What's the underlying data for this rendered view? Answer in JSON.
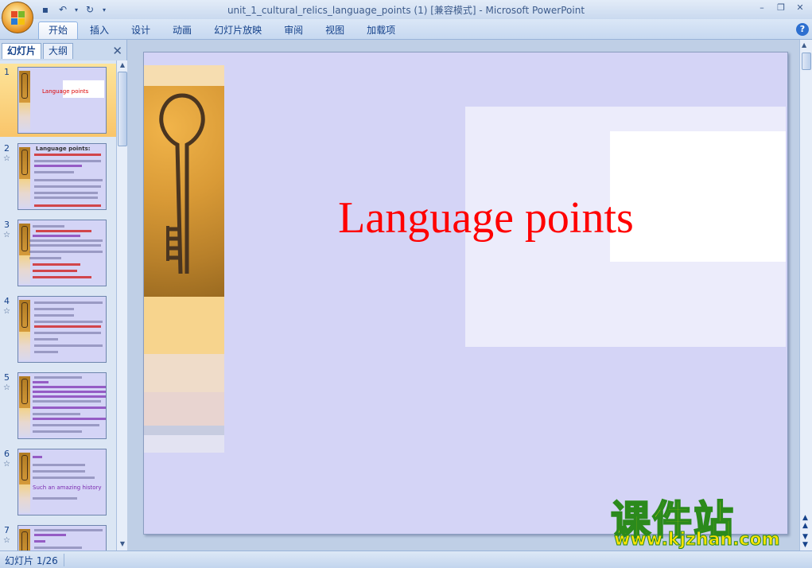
{
  "window": {
    "title": "unit_1_cultural_relics_language_points (1) [兼容模式] - Microsoft PowerPoint"
  },
  "ribbon": {
    "tabs": [
      "开始",
      "插入",
      "设计",
      "动画",
      "幻灯片放映",
      "审阅",
      "视图",
      "加载项"
    ],
    "active_tab": "开始"
  },
  "panel": {
    "tabs": [
      "幻灯片",
      "大纲"
    ],
    "active_tab": "幻灯片",
    "close_label": "✕",
    "thumbnails": [
      {
        "number": "1",
        "title": "Language points",
        "has_animation": false
      },
      {
        "number": "2",
        "title": "Language points:",
        "has_animation": true
      },
      {
        "number": "3",
        "title": "",
        "has_animation": true
      },
      {
        "number": "4",
        "title": "",
        "has_animation": true
      },
      {
        "number": "5",
        "title": "",
        "has_animation": true
      },
      {
        "number": "6",
        "title": "Such an amazing history",
        "has_animation": true
      },
      {
        "number": "7",
        "title": "",
        "has_animation": true
      }
    ]
  },
  "slide": {
    "title": "Language points"
  },
  "watermark": {
    "brand": "课件站",
    "url": "www.kjzhan.com"
  },
  "status": {
    "slide_indicator": "幻灯片 1/26"
  },
  "colors": {
    "slide_bg": "#d4d4f6",
    "title": "#ff0000",
    "selected_thumb": "#f9c56a"
  }
}
